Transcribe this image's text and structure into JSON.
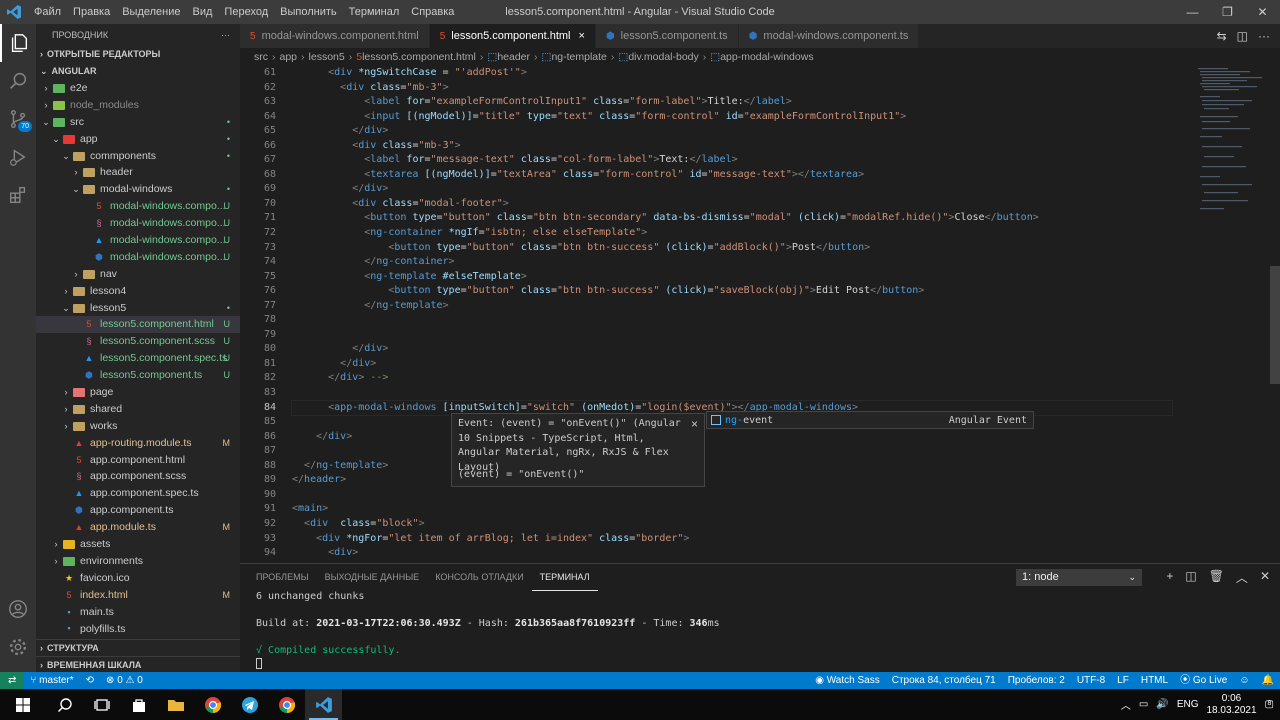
{
  "window": {
    "title": "lesson5.component.html - Angular - Visual Studio Code"
  },
  "menu": [
    "Файл",
    "Правка",
    "Выделение",
    "Вид",
    "Переход",
    "Выполнить",
    "Терминал",
    "Справка"
  ],
  "window_controls": {
    "minimize": "—",
    "restore": "❐",
    "close": "✕"
  },
  "sidebar": {
    "title": "ПРОВОДНИК",
    "more": "···",
    "open_editors": "ОТКРЫТЫЕ РЕДАКТОРЫ",
    "project": "ANGULAR",
    "outline": "СТРУКТУРА",
    "timeline": "ВРЕМЕННАЯ ШКАЛА",
    "activity_badge": "70"
  },
  "tree": [
    {
      "name": "e2e",
      "indent": 1,
      "type": "folder",
      "open": false,
      "color": "#5fb55f"
    },
    {
      "name": "node_modules",
      "indent": 1,
      "type": "folder",
      "open": false,
      "color": "#8bc34a",
      "dim": true
    },
    {
      "name": "src",
      "indent": 1,
      "type": "folder",
      "open": true,
      "color": "#5fb55f",
      "badge": "•",
      "badge_color": "#73c991"
    },
    {
      "name": "app",
      "indent": 2,
      "type": "folder",
      "open": true,
      "color": "#e53935",
      "badge": "•",
      "badge_color": "#73c991"
    },
    {
      "name": "commponents",
      "indent": 3,
      "type": "folder",
      "open": true,
      "color": "#c0a060",
      "badge": "•",
      "badge_color": "#73c991"
    },
    {
      "name": "header",
      "indent": 4,
      "type": "folder",
      "open": false,
      "color": "#c0a060"
    },
    {
      "name": "modal-windows",
      "indent": 4,
      "type": "folder",
      "open": true,
      "color": "#c0a060",
      "badge": "•",
      "badge_color": "#73c991"
    },
    {
      "name": "modal-windows.compo...",
      "indent": 5,
      "type": "html",
      "badge": "U",
      "badge_color": "#73c991",
      "text_color": "#73c991"
    },
    {
      "name": "modal-windows.compo...",
      "indent": 5,
      "type": "scss",
      "badge": "U",
      "badge_color": "#73c991",
      "text_color": "#73c991"
    },
    {
      "name": "modal-windows.compo...",
      "indent": 5,
      "type": "spec",
      "badge": "U",
      "badge_color": "#73c991",
      "text_color": "#73c991"
    },
    {
      "name": "modal-windows.compo...",
      "indent": 5,
      "type": "ts",
      "badge": "U",
      "badge_color": "#73c991",
      "text_color": "#73c991"
    },
    {
      "name": "nav",
      "indent": 4,
      "type": "folder",
      "open": false,
      "color": "#c0a060"
    },
    {
      "name": "lesson4",
      "indent": 3,
      "type": "folder",
      "open": false,
      "color": "#c0a060"
    },
    {
      "name": "lesson5",
      "indent": 3,
      "type": "folder",
      "open": true,
      "color": "#c0a060",
      "badge": "•",
      "badge_color": "#73c991"
    },
    {
      "name": "lesson5.component.html",
      "indent": 4,
      "type": "html",
      "badge": "U",
      "badge_color": "#73c991",
      "text_color": "#73c991",
      "selected": true
    },
    {
      "name": "lesson5.component.scss",
      "indent": 4,
      "type": "scss",
      "badge": "U",
      "badge_color": "#73c991",
      "text_color": "#73c991"
    },
    {
      "name": "lesson5.component.spec.ts",
      "indent": 4,
      "type": "spec",
      "badge": "U",
      "badge_color": "#73c991",
      "text_color": "#73c991"
    },
    {
      "name": "lesson5.component.ts",
      "indent": 4,
      "type": "ts",
      "badge": "U",
      "badge_color": "#73c991",
      "text_color": "#73c991"
    },
    {
      "name": "page",
      "indent": 3,
      "type": "folder",
      "open": false,
      "color": "#e57373"
    },
    {
      "name": "shared",
      "indent": 3,
      "type": "folder",
      "open": false,
      "color": "#c0a060"
    },
    {
      "name": "works",
      "indent": 3,
      "type": "folder",
      "open": false,
      "color": "#c0a060"
    },
    {
      "name": "app-routing.module.ts",
      "indent": 3,
      "type": "module",
      "badge": "M",
      "badge_color": "#e2c08d",
      "text_color": "#e2c08d"
    },
    {
      "name": "app.component.html",
      "indent": 3,
      "type": "html"
    },
    {
      "name": "app.component.scss",
      "indent": 3,
      "type": "scss"
    },
    {
      "name": "app.component.spec.ts",
      "indent": 3,
      "type": "spec"
    },
    {
      "name": "app.component.ts",
      "indent": 3,
      "type": "ts"
    },
    {
      "name": "app.module.ts",
      "indent": 3,
      "type": "module",
      "badge": "M",
      "badge_color": "#e2c08d",
      "text_color": "#e2c08d"
    },
    {
      "name": "assets",
      "indent": 2,
      "type": "folder",
      "open": false,
      "color": "#e6b422"
    },
    {
      "name": "environments",
      "indent": 2,
      "type": "folder",
      "open": false,
      "color": "#5fb55f"
    },
    {
      "name": "favicon.ico",
      "indent": 2,
      "type": "ico"
    },
    {
      "name": "index.html",
      "indent": 2,
      "type": "html",
      "badge": "M",
      "badge_color": "#e2c08d",
      "text_color": "#e2c08d"
    },
    {
      "name": "main.ts",
      "indent": 2,
      "type": "main"
    },
    {
      "name": "polyfills.ts",
      "indent": 2,
      "type": "main"
    }
  ],
  "tabs": [
    {
      "label": "modal-windows.component.html",
      "icon": "html",
      "active": false
    },
    {
      "label": "lesson5.component.html",
      "icon": "html",
      "active": true,
      "close": "×"
    },
    {
      "label": "lesson5.component.ts",
      "icon": "ts",
      "active": false
    },
    {
      "label": "modal-windows.component.ts",
      "icon": "ts",
      "active": false
    }
  ],
  "breadcrumb": [
    "src",
    "app",
    "lesson5",
    "lesson5.component.html",
    "header",
    "ng-template",
    "div.modal-body",
    "app-modal-windows"
  ],
  "editor": {
    "current_line": "84",
    "lines": [
      {
        "n": "61",
        "html": "      <span class=\"tg\">&lt;</span><span class=\"tn\">div</span> <span class=\"at\">*ngSwitchCase</span> = <span class=\"st\">\"'addPost'\"</span><span class=\"tg\">&gt;</span>"
      },
      {
        "n": "62",
        "html": "        <span class=\"tg\">&lt;</span><span class=\"tn\">div</span> <span class=\"at\">class</span>=<span class=\"st\">\"mb-3\"</span><span class=\"tg\">&gt;</span>"
      },
      {
        "n": "63",
        "html": "            <span class=\"tg\">&lt;</span><span class=\"tn\">label</span> <span class=\"at\">for</span>=<span class=\"st\">\"exampleFormControlInput1\"</span> <span class=\"at\">class</span>=<span class=\"st\">\"form-label\"</span><span class=\"tg\">&gt;</span>Title:<span class=\"tg\">&lt;/</span><span class=\"tn\">label</span><span class=\"tg\">&gt;</span>"
      },
      {
        "n": "64",
        "html": "            <span class=\"tg\">&lt;</span><span class=\"tn\">input</span> <span class=\"at\">[(ngModel)]</span>=<span class=\"st\">\"title\"</span> <span class=\"at\">type</span>=<span class=\"st\">\"text\"</span> <span class=\"at\">class</span>=<span class=\"st\">\"form-control\"</span> <span class=\"at\">id</span>=<span class=\"st\">\"exampleFormControlInput1\"</span><span class=\"tg\">&gt;</span>"
      },
      {
        "n": "65",
        "html": "          <span class=\"tg\">&lt;/</span><span class=\"tn\">div</span><span class=\"tg\">&gt;</span>"
      },
      {
        "n": "66",
        "html": "          <span class=\"tg\">&lt;</span><span class=\"tn\">div</span> <span class=\"at\">class</span>=<span class=\"st\">\"mb-3\"</span><span class=\"tg\">&gt;</span>"
      },
      {
        "n": "67",
        "html": "            <span class=\"tg\">&lt;</span><span class=\"tn\">label</span> <span class=\"at\">for</span>=<span class=\"st\">\"message-text\"</span> <span class=\"at\">class</span>=<span class=\"st\">\"col-form-label\"</span><span class=\"tg\">&gt;</span>Text:<span class=\"tg\">&lt;/</span><span class=\"tn\">label</span><span class=\"tg\">&gt;</span>"
      },
      {
        "n": "68",
        "html": "            <span class=\"tg\">&lt;</span><span class=\"tn\">textarea</span> <span class=\"at\">[(ngModel)]</span>=<span class=\"st\">\"textArea\"</span> <span class=\"at\">class</span>=<span class=\"st\">\"form-control\"</span> <span class=\"at\">id</span>=<span class=\"st\">\"message-text\"</span><span class=\"tg\">&gt;&lt;/</span><span class=\"tn\">textarea</span><span class=\"tg\">&gt;</span>"
      },
      {
        "n": "69",
        "html": "          <span class=\"tg\">&lt;/</span><span class=\"tn\">div</span><span class=\"tg\">&gt;</span>"
      },
      {
        "n": "70",
        "html": "          <span class=\"tg\">&lt;</span><span class=\"tn\">div</span> <span class=\"at\">class</span>=<span class=\"st\">\"modal-footer\"</span><span class=\"tg\">&gt;</span>"
      },
      {
        "n": "71",
        "html": "            <span class=\"tg\">&lt;</span><span class=\"tn\">button</span> <span class=\"at\">type</span>=<span class=\"st\">\"button\"</span> <span class=\"at\">class</span>=<span class=\"st\">\"btn btn-secondary\"</span> <span class=\"at\">data-bs-dismiss</span>=<span class=\"st\">\"modal\"</span> <span class=\"at\">(click)</span>=<span class=\"st\">\"modalRef.hide()\"</span><span class=\"tg\">&gt;</span>Close<span class=\"tg\">&lt;/</span><span class=\"tn\">button</span><span class=\"tg\">&gt;</span>"
      },
      {
        "n": "72",
        "html": "            <span class=\"tg\">&lt;</span><span class=\"tn\">ng-container</span> <span class=\"at\">*ngIf</span>=<span class=\"st\">\"isbtn; else elseTemplate\"</span><span class=\"tg\">&gt;</span>"
      },
      {
        "n": "73",
        "html": "                <span class=\"tg\">&lt;</span><span class=\"tn\">button</span> <span class=\"at\">type</span>=<span class=\"st\">\"button\"</span> <span class=\"at\">class</span>=<span class=\"st\">\"btn btn-success\"</span> <span class=\"at\">(click)</span>=<span class=\"st\">\"addBlock()\"</span><span class=\"tg\">&gt;</span>Post<span class=\"tg\">&lt;/</span><span class=\"tn\">button</span><span class=\"tg\">&gt;</span>"
      },
      {
        "n": "74",
        "html": "            <span class=\"tg\">&lt;/</span><span class=\"tn\">ng-container</span><span class=\"tg\">&gt;</span>"
      },
      {
        "n": "75",
        "html": "            <span class=\"tg\">&lt;</span><span class=\"tn\">ng-template</span> <span class=\"at\">#elseTemplate</span><span class=\"tg\">&gt;</span>"
      },
      {
        "n": "76",
        "html": "                <span class=\"tg\">&lt;</span><span class=\"tn\">button</span> <span class=\"at\">type</span>=<span class=\"st\">\"button\"</span> <span class=\"at\">class</span>=<span class=\"st\">\"btn btn-success\"</span> <span class=\"at\">(click)</span>=<span class=\"st\">\"saveBlock(obj)\"</span><span class=\"tg\">&gt;</span>Edit Post<span class=\"tg\">&lt;/</span><span class=\"tn\">button</span><span class=\"tg\">&gt;</span>"
      },
      {
        "n": "77",
        "html": "            <span class=\"tg\">&lt;/</span><span class=\"tn\">ng-template</span><span class=\"tg\">&gt;</span>"
      },
      {
        "n": "78",
        "html": ""
      },
      {
        "n": "79",
        "html": ""
      },
      {
        "n": "80",
        "html": "          <span class=\"tg\">&lt;/</span><span class=\"tn\">div</span><span class=\"tg\">&gt;</span>"
      },
      {
        "n": "81",
        "html": "        <span class=\"tg\">&lt;/</span><span class=\"tn\">div</span><span class=\"tg\">&gt;</span>"
      },
      {
        "n": "82",
        "html": "      <span class=\"tg\">&lt;/</span><span class=\"tn\">div</span><span class=\"tg\">&gt;</span> <span class=\"cm\">--&gt;</span>"
      },
      {
        "n": "83",
        "html": ""
      },
      {
        "n": "84",
        "html": "      <span class=\"tg\">&lt;</span><span class=\"tn\">app-modal-windows</span> <span class=\"at\">[inputSwitch]</span>=<span class=\"st\">\"switch\"</span> <span class=\"at\">(onMedot)</span>=<span class=\"st\">\"login($event)\"</span><span class=\"tg\">&gt;&lt;/</span><span class=\"tn\">app-modal-windows</span><span class=\"tg\">&gt;</span>",
        "current": true
      },
      {
        "n": "85",
        "html": ""
      },
      {
        "n": "86",
        "html": "    <span class=\"tg\">&lt;/</span><span class=\"tn\">div</span><span class=\"tg\">&gt;</span>"
      },
      {
        "n": "87",
        "html": ""
      },
      {
        "n": "88",
        "html": "  <span class=\"tg\">&lt;/</span><span class=\"tn\">ng-template</span><span class=\"tg\">&gt;</span>"
      },
      {
        "n": "89",
        "html": "<span class=\"tg\">&lt;/</span><span class=\"tn\">header</span><span class=\"tg\">&gt;</span>"
      },
      {
        "n": "90",
        "html": ""
      },
      {
        "n": "91",
        "html": "<span class=\"tg\">&lt;</span><span class=\"tn\">main</span><span class=\"tg\">&gt;</span>"
      },
      {
        "n": "92",
        "html": "  <span class=\"tg\">&lt;</span><span class=\"tn\">div</span>  <span class=\"at\">class</span>=<span class=\"st\">\"block\"</span><span class=\"tg\">&gt;</span>"
      },
      {
        "n": "93",
        "html": "    <span class=\"tg\">&lt;</span><span class=\"tn\">div</span> <span class=\"at\">*ngFor</span>=<span class=\"st\">\"let item of arrBlog; let i=index\"</span> <span class=\"at\">class</span>=<span class=\"st\">\"border\"</span><span class=\"tg\">&gt;</span>"
      },
      {
        "n": "94",
        "html": "      <span class=\"tg\">&lt;</span><span class=\"tn\">div</span><span class=\"tg\">&gt;</span>"
      }
    ]
  },
  "hover": {
    "text": "Event: (event) = \"onEvent()\" (Angular 10 Snippets - TypeScript, Html, Angular Material, ngRx, RxJS & Flex Layout)",
    "signature": "(event) = \"onEvent()\"",
    "close": "×"
  },
  "suggest": {
    "match": "ng-",
    "rest": "event",
    "detail": "Angular Event"
  },
  "panel": {
    "tabs": [
      {
        "label": "ПРОБЛЕМЫ",
        "active": false
      },
      {
        "label": "ВЫХОДНЫЕ ДАННЫЕ",
        "active": false
      },
      {
        "label": "КОНСОЛЬ ОТЛАДКИ",
        "active": false
      },
      {
        "label": "ТЕРМИНАЛ",
        "active": true
      }
    ],
    "terminal_select": "1: node",
    "actions": [
      "+",
      "◫",
      "🗑",
      "︿",
      "✕"
    ]
  },
  "terminal": {
    "line1": "6 unchanged chunks",
    "build_prefix": "Build at: ",
    "build_date": "2021-03-17T22:06:30.493Z",
    "hash_prefix": " - Hash: ",
    "hash": "261b365aa8f7610923ff",
    "time_prefix": " - Time: ",
    "time": "346",
    "time_unit": "ms",
    "check": "√",
    "compiled": " Compiled successfully."
  },
  "status": {
    "branch": "master*",
    "sync": "⟲",
    "errors": "0",
    "warnings": "0",
    "watch": "Watch Sass",
    "position": "Строка 84, столбец 71",
    "spaces": "Пробелов: 2",
    "encoding": "UTF-8",
    "eol": "LF",
    "language": "HTML",
    "golive": "Go Live"
  },
  "taskbar": {
    "lang": "ENG",
    "time": "0:06",
    "date": "18.03.2021",
    "notif": "8"
  }
}
